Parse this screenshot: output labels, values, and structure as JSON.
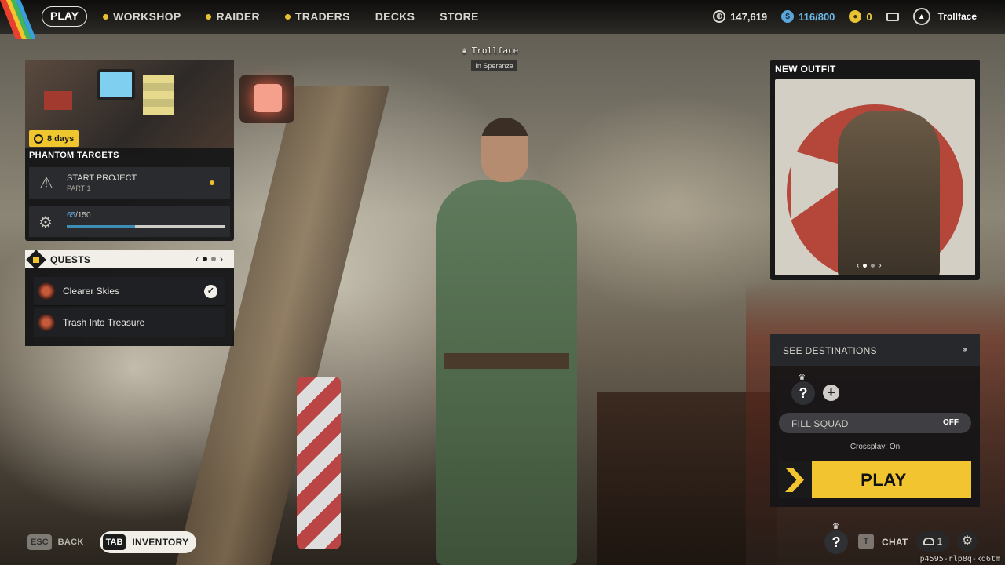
{
  "nav": {
    "play": "PLAY",
    "items": [
      {
        "label": "WORKSHOP",
        "dot": true
      },
      {
        "label": "RAIDER",
        "dot": true
      },
      {
        "label": "TRADERS",
        "dot": true
      },
      {
        "label": "DECKS",
        "dot": false
      },
      {
        "label": "STORE",
        "dot": false
      }
    ]
  },
  "currencies": {
    "coins": "147,619",
    "tokens": "116/800",
    "raider_tokens": "0"
  },
  "profile": {
    "name": "Trollface"
  },
  "nametag": {
    "name": "Trollface",
    "location": "In Speranza"
  },
  "phantom": {
    "days": "8 days",
    "title": "PHANTOM TARGETS",
    "project_title": "START PROJECT",
    "project_sub": "PART 1",
    "progress_current": "65",
    "progress_total": "/150",
    "progress_fraction": 0.433
  },
  "quests": {
    "title": "QUESTS",
    "page_prev": "‹",
    "page_next": "›",
    "items": [
      {
        "name": "Clearer Skies",
        "completed": true
      },
      {
        "name": "Trash Into Treasure",
        "completed": false
      }
    ]
  },
  "outfit": {
    "title": "NEW OUTFIT",
    "pager_prev": "‹",
    "pager_next": "›"
  },
  "destinations": {
    "label": "SEE DESTINATIONS",
    "arrows": "›››",
    "slot": "?",
    "add": "+",
    "fill_squad": "FILL SQUAD",
    "fill_squad_state": "OFF",
    "crossplay": "Crossplay: On",
    "play": "PLAY"
  },
  "bottom": {
    "esc_key": "ESC",
    "back": "BACK",
    "tab_key": "TAB",
    "inventory": "INVENTORY",
    "slot": "?",
    "chat_key": "T",
    "chat": "CHAT",
    "friends_count": "1"
  },
  "build_id": "p4595-rlp8q-kd6tm",
  "colors": {
    "accent_yellow": "#f2c530",
    "token_blue": "#5aa6d8",
    "progress_blue": "#3e8db5"
  }
}
